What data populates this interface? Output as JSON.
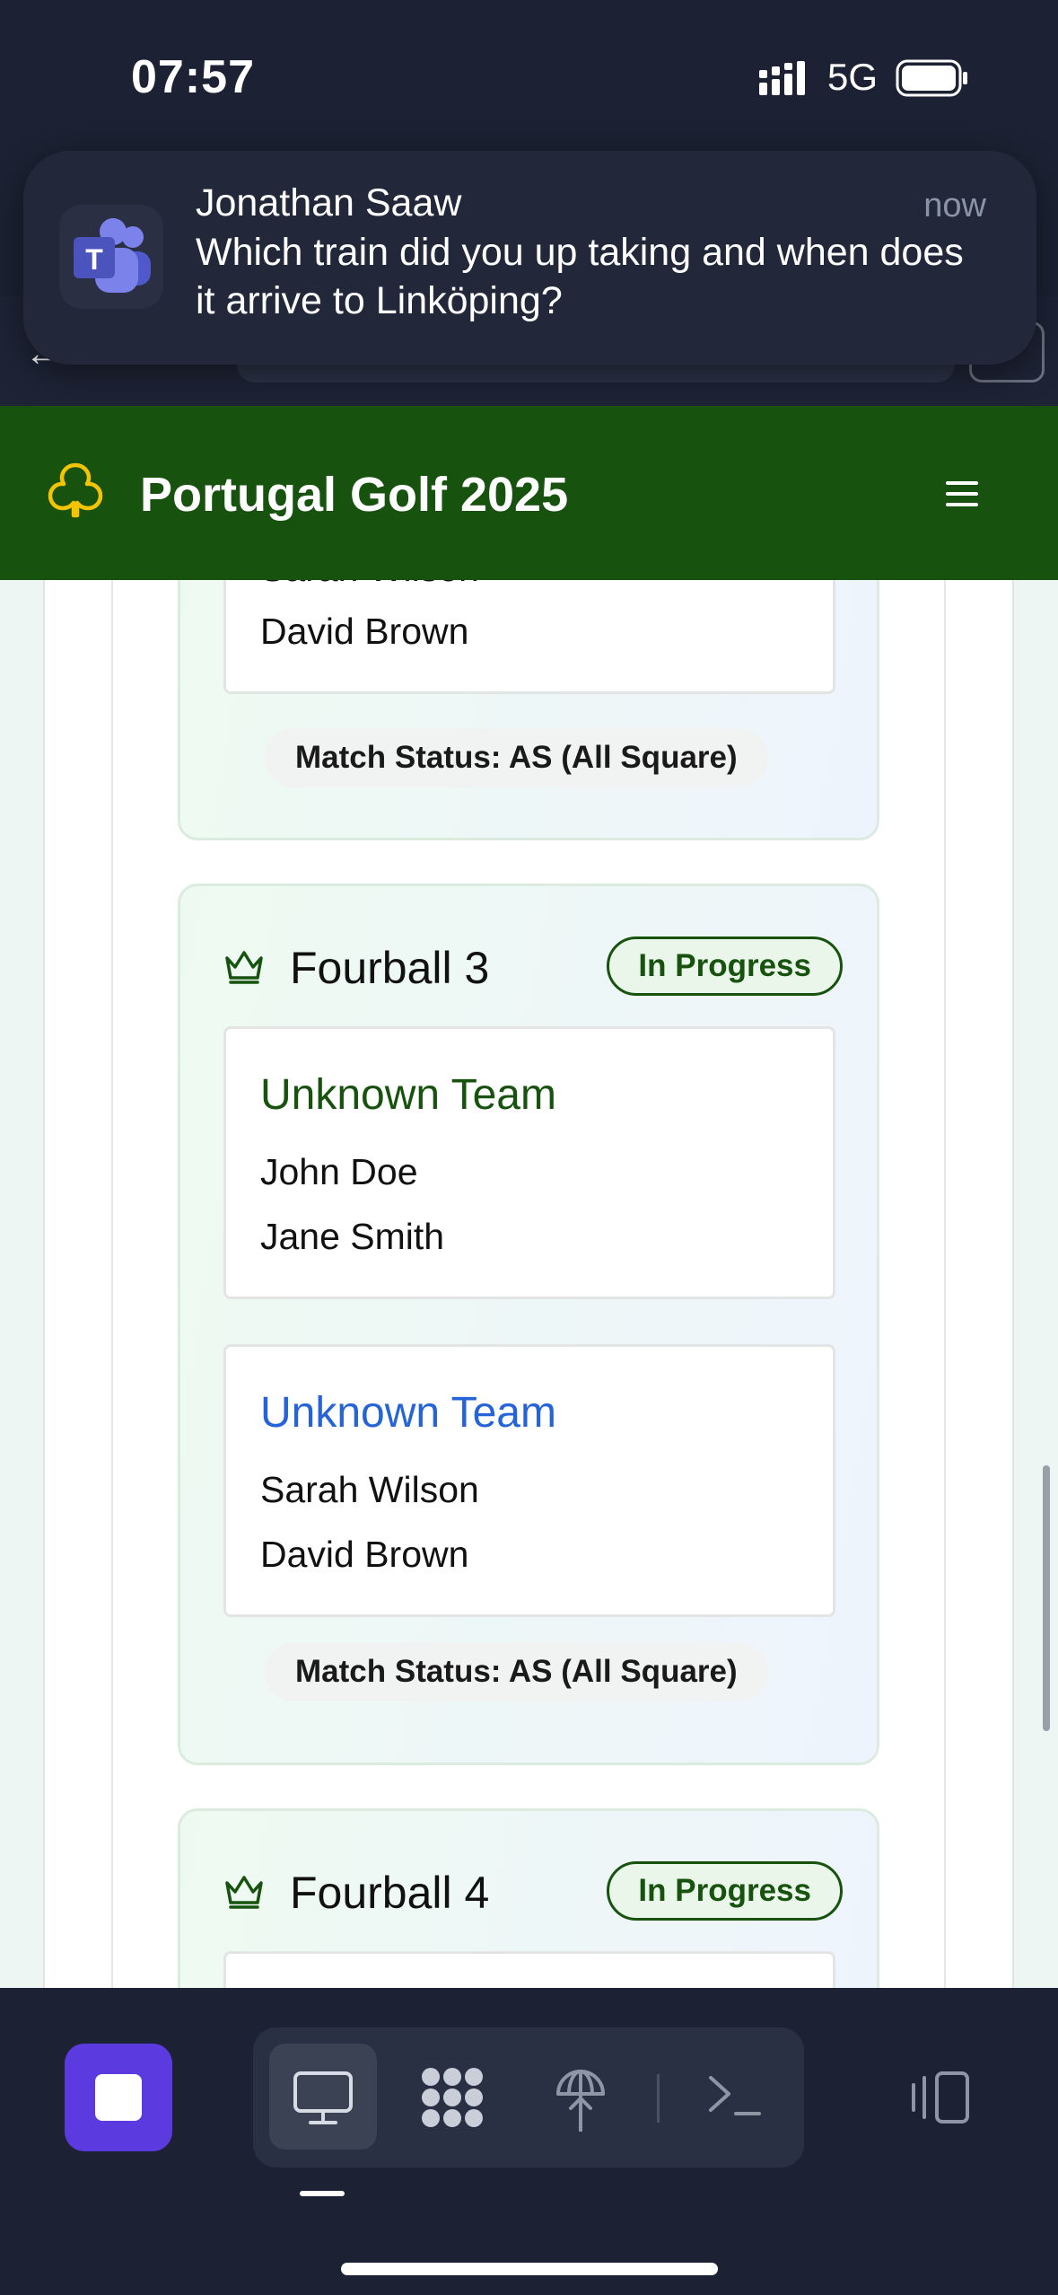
{
  "status_bar": {
    "time": "07:57",
    "network": "5G"
  },
  "notification": {
    "app_icon": "teams-icon",
    "sender": "Jonathan Saaw",
    "time": "now",
    "message": "Which train did you up taking and when does it arrive to Linköping?"
  },
  "app": {
    "title": "Portugal Golf 2025",
    "logo_icon": "club-icon",
    "menu_icon": "menu-icon"
  },
  "partial_match": {
    "partial_player": "Sarah Wilson",
    "player": "David Brown",
    "status": "Match Status: AS (All Square)"
  },
  "matches": [
    {
      "title": "Fourball 3",
      "badge": "In Progress",
      "team1": {
        "name": "Unknown Team",
        "players": [
          "John Doe",
          "Jane Smith"
        ]
      },
      "team2": {
        "name": "Unknown Team",
        "players": [
          "Sarah Wilson",
          "David Brown"
        ]
      },
      "status": "Match Status: AS (All Square)"
    },
    {
      "title": "Fourball 4",
      "badge": "In Progress"
    }
  ],
  "colors": {
    "header_green": "#17520f",
    "team1": "#17520f",
    "team2": "#2563d9",
    "stop_button": "#5b3ae0"
  },
  "dock": {
    "icons": [
      "stop-icon",
      "desktop-icon",
      "apps-icon",
      "network-icon",
      "terminal-icon",
      "split-view-icon"
    ],
    "selected": "desktop-icon"
  }
}
